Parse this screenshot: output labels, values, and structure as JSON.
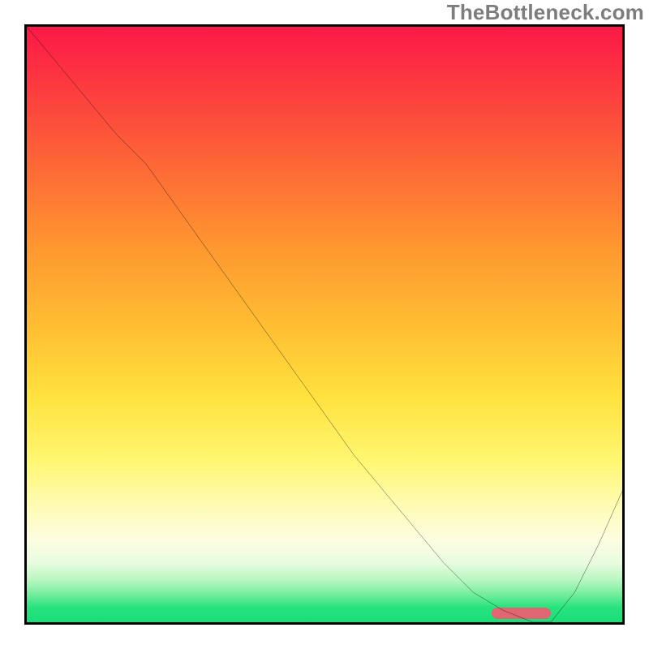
{
  "watermark": "TheBottleneck.com",
  "chart_data": {
    "type": "line",
    "title": "",
    "xlabel": "",
    "ylabel": "",
    "xlim": [
      0,
      100
    ],
    "ylim": [
      0,
      100
    ],
    "grid": false,
    "series": [
      {
        "name": "bottleneck-curve",
        "x": [
          0,
          5,
          10,
          15,
          20,
          25,
          30,
          35,
          40,
          45,
          50,
          55,
          60,
          65,
          70,
          75,
          80,
          85,
          88,
          92,
          96,
          100
        ],
        "y": [
          100,
          94,
          88,
          82,
          77,
          70,
          63,
          56,
          49,
          42,
          35,
          28,
          22,
          16,
          10,
          5,
          2,
          0,
          0,
          5,
          13,
          22
        ]
      }
    ],
    "optimal_marker": {
      "x_start": 78,
      "x_end": 88,
      "y": 1.5
    }
  },
  "colors": {
    "line": "#000000",
    "marker": "#e06671",
    "border": "#000000",
    "watermark": "#7d7d7d"
  }
}
